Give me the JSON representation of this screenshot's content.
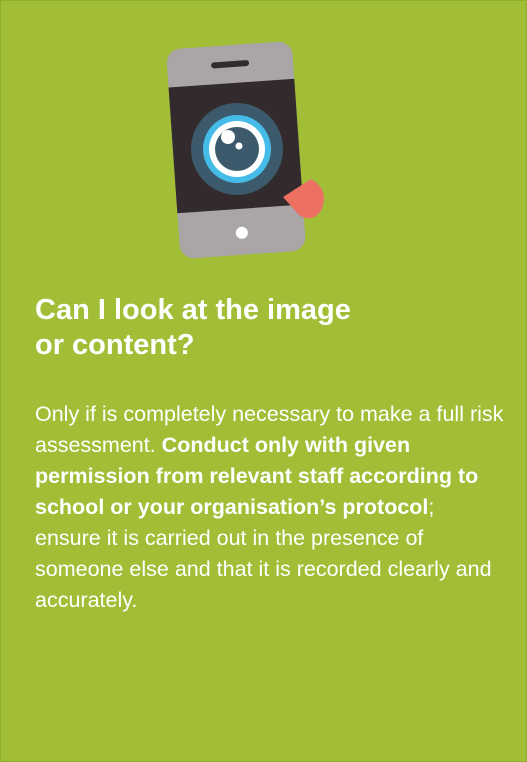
{
  "card": {
    "background": "#a2be36",
    "illustration": {
      "icon": "smartphone-camera-lens-icon",
      "colors": {
        "phone_body": "#aaa6a8",
        "screen": "#332a2d",
        "lens_ring": "#45bce8",
        "lens_center": "#3d5a6d",
        "tongue": "#ec7163"
      }
    },
    "heading_line1": "Can I look at the image",
    "heading_line2": "or content?",
    "body": {
      "part1": "Only if is completely necessary to make a full risk assessment. ",
      "part2_bold": "Conduct only with given permission from relevant staff according to school or your organisation’s protocol",
      "part3": "; ensure it is carried out in the presence of someone else and that it is recorded clearly and accurately."
    }
  }
}
